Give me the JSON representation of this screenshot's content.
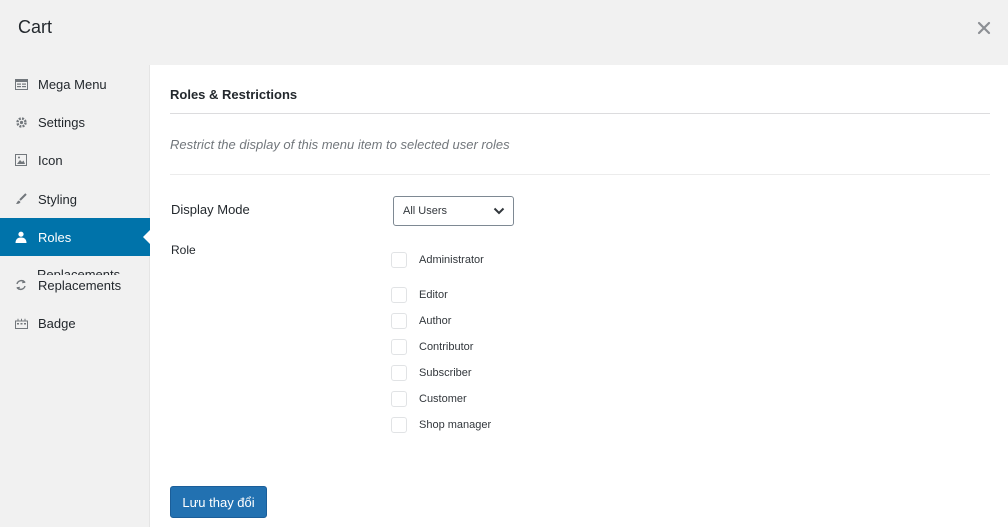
{
  "dialog": {
    "title": "Cart",
    "close_icon": "close-icon"
  },
  "sidebar": {
    "items": [
      {
        "label": "Mega Menu",
        "icon": "mega-menu-icon"
      },
      {
        "label": "Settings",
        "icon": "gear-icon"
      },
      {
        "label": "Icon",
        "icon": "image-icon"
      },
      {
        "label": "Styling",
        "icon": "brush-icon"
      },
      {
        "label": "Roles",
        "icon": "user-icon",
        "active": true
      },
      {
        "label": "Replacements",
        "icon": "refresh-icon"
      },
      {
        "label": "Badge",
        "icon": "badge-icon"
      }
    ],
    "ghost_label": "Replacements"
  },
  "main": {
    "section_title": "Roles & Restrictions",
    "description": "Restrict the display of this menu item to selected user roles",
    "display_mode": {
      "label": "Display Mode",
      "value": "All Users"
    },
    "role": {
      "label": "Role",
      "options": [
        "Administrator",
        "Editor",
        "Author",
        "Contributor",
        "Subscriber",
        "Customer",
        "Shop manager"
      ]
    },
    "save_label": "Lưu thay đổi"
  },
  "colors": {
    "accent": "#0073aa",
    "button": "#2271b1",
    "header_bg": "#f1f1f1"
  }
}
